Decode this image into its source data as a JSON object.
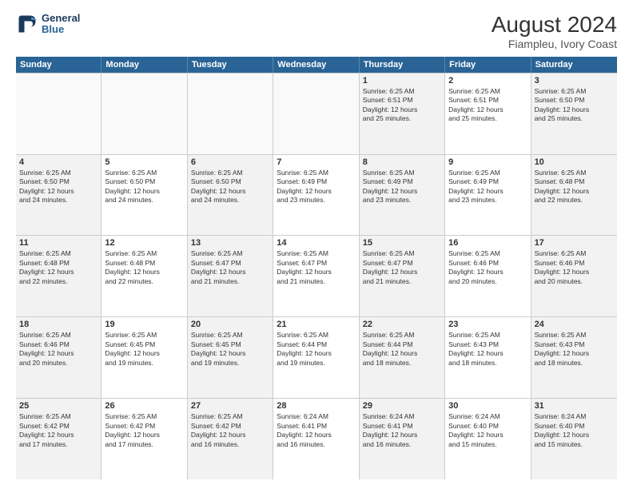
{
  "logo": {
    "line1": "General",
    "line2": "Blue"
  },
  "title": "August 2024",
  "subtitle": "Fiampleu, Ivory Coast",
  "weekdays": [
    "Sunday",
    "Monday",
    "Tuesday",
    "Wednesday",
    "Thursday",
    "Friday",
    "Saturday"
  ],
  "weeks": [
    [
      {
        "day": "",
        "empty": true
      },
      {
        "day": "",
        "empty": true
      },
      {
        "day": "",
        "empty": true
      },
      {
        "day": "",
        "empty": true
      },
      {
        "day": "1",
        "line1": "Sunrise: 6:25 AM",
        "line2": "Sunset: 6:51 PM",
        "line3": "Daylight: 12 hours",
        "line4": "and 25 minutes."
      },
      {
        "day": "2",
        "line1": "Sunrise: 6:25 AM",
        "line2": "Sunset: 6:51 PM",
        "line3": "Daylight: 12 hours",
        "line4": "and 25 minutes."
      },
      {
        "day": "3",
        "line1": "Sunrise: 6:25 AM",
        "line2": "Sunset: 6:50 PM",
        "line3": "Daylight: 12 hours",
        "line4": "and 25 minutes."
      }
    ],
    [
      {
        "day": "4",
        "line1": "Sunrise: 6:25 AM",
        "line2": "Sunset: 6:50 PM",
        "line3": "Daylight: 12 hours",
        "line4": "and 24 minutes."
      },
      {
        "day": "5",
        "line1": "Sunrise: 6:25 AM",
        "line2": "Sunset: 6:50 PM",
        "line3": "Daylight: 12 hours",
        "line4": "and 24 minutes."
      },
      {
        "day": "6",
        "line1": "Sunrise: 6:25 AM",
        "line2": "Sunset: 6:50 PM",
        "line3": "Daylight: 12 hours",
        "line4": "and 24 minutes."
      },
      {
        "day": "7",
        "line1": "Sunrise: 6:25 AM",
        "line2": "Sunset: 6:49 PM",
        "line3": "Daylight: 12 hours",
        "line4": "and 23 minutes."
      },
      {
        "day": "8",
        "line1": "Sunrise: 6:25 AM",
        "line2": "Sunset: 6:49 PM",
        "line3": "Daylight: 12 hours",
        "line4": "and 23 minutes."
      },
      {
        "day": "9",
        "line1": "Sunrise: 6:25 AM",
        "line2": "Sunset: 6:49 PM",
        "line3": "Daylight: 12 hours",
        "line4": "and 23 minutes."
      },
      {
        "day": "10",
        "line1": "Sunrise: 6:25 AM",
        "line2": "Sunset: 6:48 PM",
        "line3": "Daylight: 12 hours",
        "line4": "and 22 minutes."
      }
    ],
    [
      {
        "day": "11",
        "line1": "Sunrise: 6:25 AM",
        "line2": "Sunset: 6:48 PM",
        "line3": "Daylight: 12 hours",
        "line4": "and 22 minutes."
      },
      {
        "day": "12",
        "line1": "Sunrise: 6:25 AM",
        "line2": "Sunset: 6:48 PM",
        "line3": "Daylight: 12 hours",
        "line4": "and 22 minutes."
      },
      {
        "day": "13",
        "line1": "Sunrise: 6:25 AM",
        "line2": "Sunset: 6:47 PM",
        "line3": "Daylight: 12 hours",
        "line4": "and 21 minutes."
      },
      {
        "day": "14",
        "line1": "Sunrise: 6:25 AM",
        "line2": "Sunset: 6:47 PM",
        "line3": "Daylight: 12 hours",
        "line4": "and 21 minutes."
      },
      {
        "day": "15",
        "line1": "Sunrise: 6:25 AM",
        "line2": "Sunset: 6:47 PM",
        "line3": "Daylight: 12 hours",
        "line4": "and 21 minutes."
      },
      {
        "day": "16",
        "line1": "Sunrise: 6:25 AM",
        "line2": "Sunset: 6:46 PM",
        "line3": "Daylight: 12 hours",
        "line4": "and 20 minutes."
      },
      {
        "day": "17",
        "line1": "Sunrise: 6:25 AM",
        "line2": "Sunset: 6:46 PM",
        "line3": "Daylight: 12 hours",
        "line4": "and 20 minutes."
      }
    ],
    [
      {
        "day": "18",
        "line1": "Sunrise: 6:25 AM",
        "line2": "Sunset: 6:46 PM",
        "line3": "Daylight: 12 hours",
        "line4": "and 20 minutes."
      },
      {
        "day": "19",
        "line1": "Sunrise: 6:25 AM",
        "line2": "Sunset: 6:45 PM",
        "line3": "Daylight: 12 hours",
        "line4": "and 19 minutes."
      },
      {
        "day": "20",
        "line1": "Sunrise: 6:25 AM",
        "line2": "Sunset: 6:45 PM",
        "line3": "Daylight: 12 hours",
        "line4": "and 19 minutes."
      },
      {
        "day": "21",
        "line1": "Sunrise: 6:25 AM",
        "line2": "Sunset: 6:44 PM",
        "line3": "Daylight: 12 hours",
        "line4": "and 19 minutes."
      },
      {
        "day": "22",
        "line1": "Sunrise: 6:25 AM",
        "line2": "Sunset: 6:44 PM",
        "line3": "Daylight: 12 hours",
        "line4": "and 18 minutes."
      },
      {
        "day": "23",
        "line1": "Sunrise: 6:25 AM",
        "line2": "Sunset: 6:43 PM",
        "line3": "Daylight: 12 hours",
        "line4": "and 18 minutes."
      },
      {
        "day": "24",
        "line1": "Sunrise: 6:25 AM",
        "line2": "Sunset: 6:43 PM",
        "line3": "Daylight: 12 hours",
        "line4": "and 18 minutes."
      }
    ],
    [
      {
        "day": "25",
        "line1": "Sunrise: 6:25 AM",
        "line2": "Sunset: 6:42 PM",
        "line3": "Daylight: 12 hours",
        "line4": "and 17 minutes."
      },
      {
        "day": "26",
        "line1": "Sunrise: 6:25 AM",
        "line2": "Sunset: 6:42 PM",
        "line3": "Daylight: 12 hours",
        "line4": "and 17 minutes."
      },
      {
        "day": "27",
        "line1": "Sunrise: 6:25 AM",
        "line2": "Sunset: 6:42 PM",
        "line3": "Daylight: 12 hours",
        "line4": "and 16 minutes."
      },
      {
        "day": "28",
        "line1": "Sunrise: 6:24 AM",
        "line2": "Sunset: 6:41 PM",
        "line3": "Daylight: 12 hours",
        "line4": "and 16 minutes."
      },
      {
        "day": "29",
        "line1": "Sunrise: 6:24 AM",
        "line2": "Sunset: 6:41 PM",
        "line3": "Daylight: 12 hours",
        "line4": "and 16 minutes."
      },
      {
        "day": "30",
        "line1": "Sunrise: 6:24 AM",
        "line2": "Sunset: 6:40 PM",
        "line3": "Daylight: 12 hours",
        "line4": "and 15 minutes."
      },
      {
        "day": "31",
        "line1": "Sunrise: 6:24 AM",
        "line2": "Sunset: 6:40 PM",
        "line3": "Daylight: 12 hours",
        "line4": "and 15 minutes."
      }
    ]
  ]
}
